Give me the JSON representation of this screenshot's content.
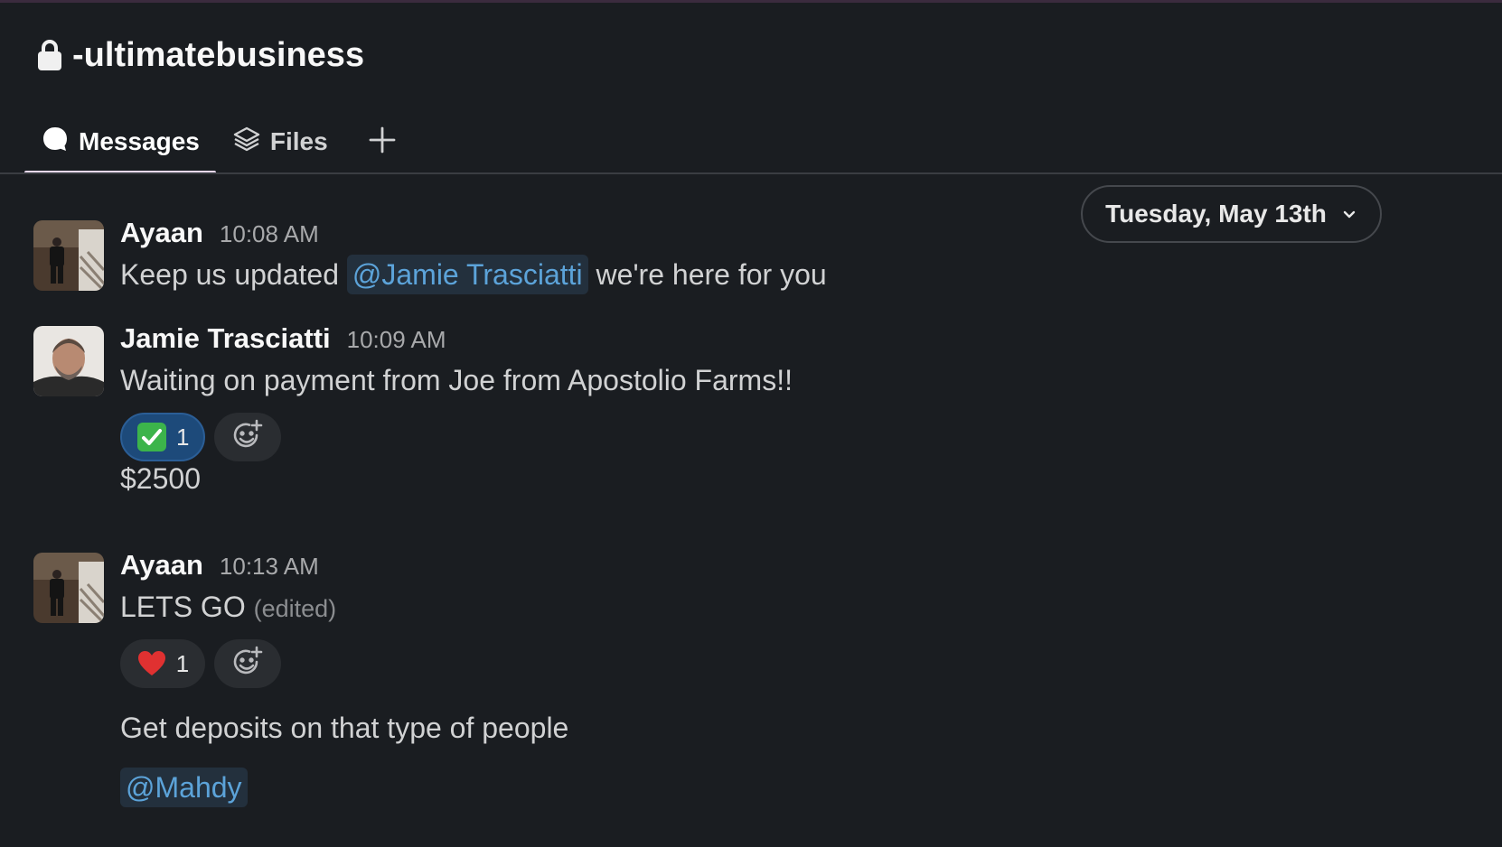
{
  "channel": {
    "name": "-ultimatebusiness",
    "icon": "lock-icon"
  },
  "tabs": [
    {
      "label": "Messages",
      "icon": "message-bubble-icon",
      "active": true
    },
    {
      "label": "Files",
      "icon": "layers-icon",
      "active": false
    }
  ],
  "date_divider": {
    "label": "Tuesday, May 13th",
    "icon": "chevron-down-icon"
  },
  "messages": [
    {
      "author": "Ayaan",
      "time": "10:08 AM",
      "text_before": "Keep us updated",
      "mention": "@Jamie Trasciatti",
      "text_after": "we're here for you"
    },
    {
      "author": "Jamie Trasciatti",
      "time": "10:09 AM",
      "text": "Waiting on payment from Joe from Apostolio Farms!!",
      "reaction": {
        "emoji": "white-check-mark",
        "count": "1"
      },
      "followup": "$2500"
    },
    {
      "author": "Ayaan",
      "time": "10:13 AM",
      "text": "LETS GO",
      "edited": "(edited)",
      "reaction": {
        "emoji": "red-heart",
        "count": "1"
      },
      "followup": "Get deposits on that type of people",
      "followup_mention": "@Mahdy"
    }
  ],
  "colors": {
    "background": "#1a1d21",
    "mention": "#5ca3d9",
    "reaction_selected": "#1d4a7a"
  }
}
